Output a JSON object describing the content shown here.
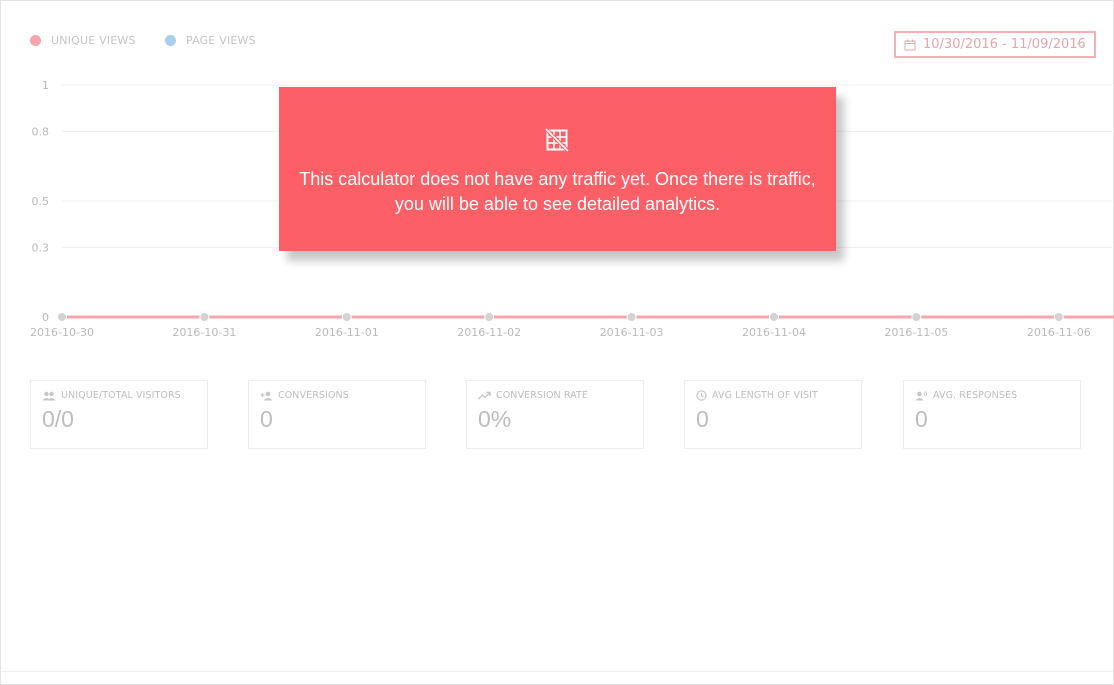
{
  "legend": {
    "unique_views": {
      "label": "UNIQUE VIEWS",
      "color": "#f5a5ab"
    },
    "page_views": {
      "label": "PAGE VIEWS",
      "color": "#a8cfee"
    }
  },
  "date_range": {
    "label": "10/30/2016 - 11/09/2016",
    "icon": "calendar-icon",
    "dropdown_icon": "chevron-down-icon"
  },
  "overlay": {
    "icon": "grid-off-icon",
    "message": "This calculator does not have any traffic yet. Once there is traffic, you will be able to see detailed analytics.",
    "background": "#fd5f66"
  },
  "chart_data": {
    "type": "line",
    "x": [
      "2016-10-30",
      "2016-10-31",
      "2016-11-01",
      "2016-11-02",
      "2016-11-03",
      "2016-11-04",
      "2016-11-05",
      "2016-11-06"
    ],
    "y_ticks": [
      "1",
      "0.8",
      "0.5",
      "0.3",
      "0"
    ],
    "ylim": [
      0,
      1
    ],
    "grid": true,
    "series": [
      {
        "name": "UNIQUE VIEWS",
        "color": "#f5a5ab",
        "values": [
          0,
          0,
          0,
          0,
          0,
          0,
          0,
          0
        ]
      },
      {
        "name": "PAGE VIEWS",
        "color": "#a8cfee",
        "values": [
          0,
          0,
          0,
          0,
          0,
          0,
          0,
          0
        ]
      }
    ]
  },
  "metrics": [
    {
      "icon": "people-icon",
      "label": "UNIQUE/TOTAL VISITORS",
      "value": "0/0"
    },
    {
      "icon": "person-add-icon",
      "label": "CONVERSIONS",
      "value": "0"
    },
    {
      "icon": "trending-up-icon",
      "label": "CONVERSION RATE",
      "value": "0%"
    },
    {
      "icon": "clock-icon",
      "label": "AVG LENGTH OF VISIT",
      "value": "0"
    },
    {
      "icon": "record-voice-icon",
      "label": "AVG. RESPONSES",
      "value": "0"
    }
  ]
}
